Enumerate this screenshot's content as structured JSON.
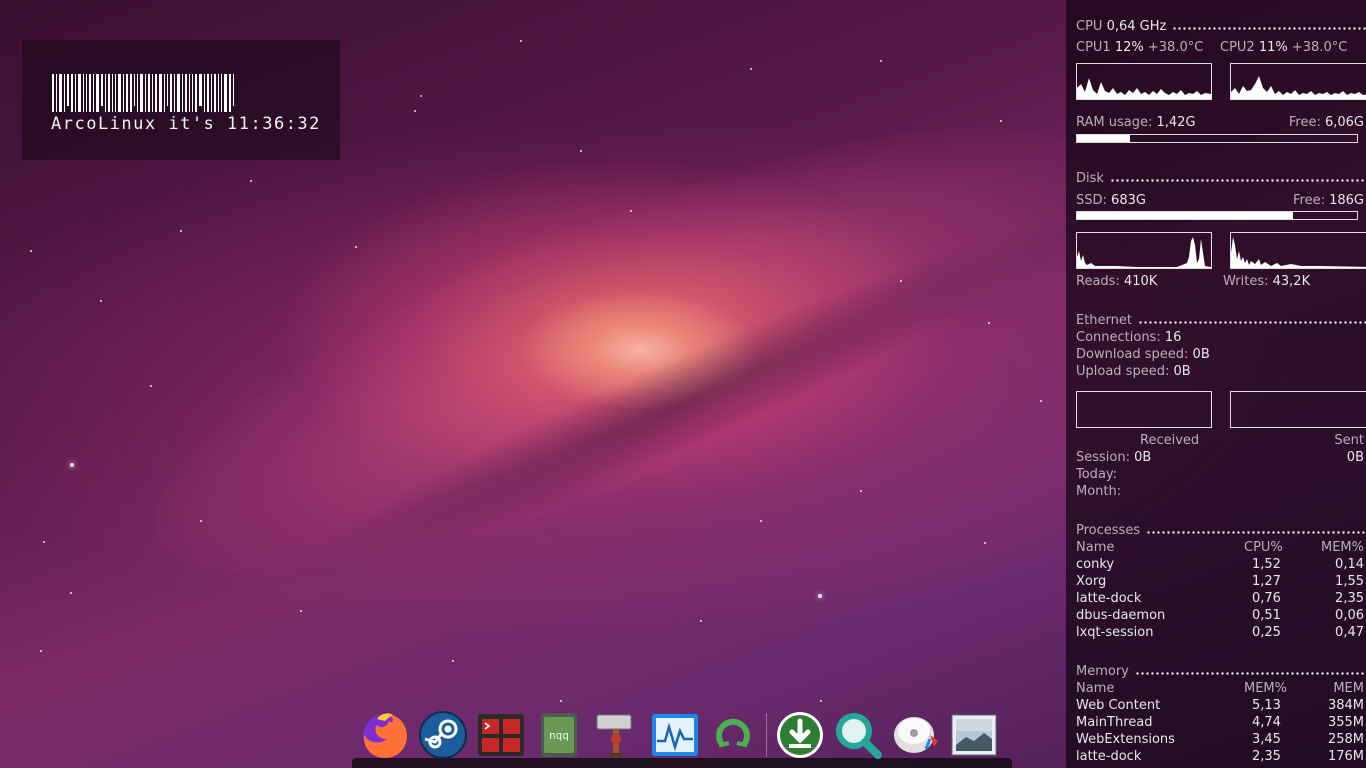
{
  "desktop": {
    "clock_widget": {
      "text": "ArcoLinux it's 11:36:32"
    },
    "conky": {
      "cpu": {
        "title": "CPU",
        "freq": "0,64 GHz",
        "cpu1_label": "CPU1",
        "cpu1_usage": "12%",
        "cpu1_temp": "+38.0°C",
        "cpu2_label": "CPU2",
        "cpu2_usage": "11%",
        "cpu2_temp": "+38.0°C"
      },
      "ram": {
        "label": "RAM usage:",
        "used": "1,42G",
        "free_label": "Free:",
        "free": "6,06G",
        "usage_fraction": 0.19
      },
      "disk": {
        "title": "Disk",
        "ssd_label": "SSD:",
        "ssd_used": "683G",
        "free_label": "Free:",
        "free": "186G",
        "usage_fraction": 0.77,
        "reads_label": "Reads:",
        "reads": "410K",
        "writes_label": "Writes:",
        "writes": "43,2K"
      },
      "ethernet": {
        "title": "Ethernet",
        "connections_label": "Connections:",
        "connections": "16",
        "download_label": "Download speed:",
        "download": "0B",
        "upload_label": "Upload speed:",
        "upload": "0B",
        "received_label": "Received",
        "sent_label": "Sent",
        "session_label": "Session:",
        "session_received": "0B",
        "session_sent": "0B",
        "today_label": "Today:",
        "month_label": "Month:"
      },
      "processes": {
        "title": "Processes",
        "headers": {
          "name": "Name",
          "cpu": "CPU%",
          "mem": "MEM%"
        },
        "rows": [
          {
            "name": "conky",
            "cpu": "1,52",
            "mem": "0,14"
          },
          {
            "name": "Xorg",
            "cpu": "1,27",
            "mem": "1,55"
          },
          {
            "name": "latte-dock",
            "cpu": "0,76",
            "mem": "2,35"
          },
          {
            "name": "dbus-daemon",
            "cpu": "0,51",
            "mem": "0,06"
          },
          {
            "name": "lxqt-session",
            "cpu": "0,25",
            "mem": "0,47"
          }
        ]
      },
      "memory": {
        "title": "Memory",
        "headers": {
          "name": "Name",
          "mempct": "MEM%",
          "mem": "MEM"
        },
        "rows": [
          {
            "name": "Web Content",
            "mempct": "5,13",
            "mem": "384M"
          },
          {
            "name": "MainThread",
            "mempct": "4,74",
            "mem": "355M"
          },
          {
            "name": "WebExtensions",
            "mempct": "3,45",
            "mem": "258M"
          },
          {
            "name": "latte-dock",
            "mempct": "2,35",
            "mem": "176M"
          }
        ]
      }
    },
    "dock": {
      "items": [
        {
          "icon": "firefox-icon",
          "accent": "#ff7139"
        },
        {
          "icon": "steam-icon",
          "accent": "#1b5e9b"
        },
        {
          "icon": "terminal-manager-icon",
          "accent": "#c62828"
        },
        {
          "icon": "notes-app-icon",
          "accent": "#6a9955",
          "label": "nqq"
        },
        {
          "icon": "hammer-tool-icon",
          "accent": "#d0d0d0"
        },
        {
          "icon": "system-monitor-icon",
          "accent": "#1e88e5"
        },
        {
          "icon": "refresh-app-icon",
          "accent": "#4caf50"
        },
        {
          "icon": "download-manager-icon",
          "accent": "#2e7d32"
        },
        {
          "icon": "search-app-icon",
          "accent": "#26a69a"
        },
        {
          "icon": "disk-utility-icon",
          "accent": "#e0e0e0"
        },
        {
          "icon": "image-viewer-icon",
          "accent": "#90a4ae"
        }
      ]
    }
  }
}
